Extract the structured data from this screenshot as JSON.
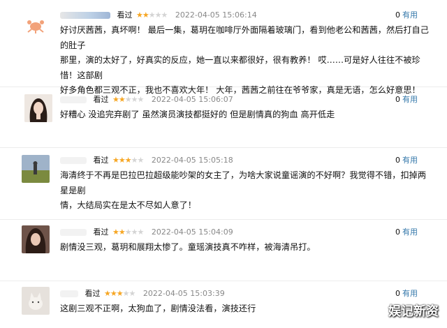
{
  "reviews": [
    {
      "status": "看过",
      "rating": 2,
      "time": "2022-04-05 15:06:14",
      "votes": "0",
      "useful_label": "有用",
      "content": "好讨厌茜茜，真坏啊！ 最后一集，葛玥在咖啡厅外面隔着玻璃门，看到他老公和茜茜，然后打自己的肚子\n那里，演的太好了，好真实的反应，她一直以来都很好，很有教养！ 哎……可是好人往往不被珍惜！这部剧\n好多角色都三观不正，我也不喜欢大年！ 大年，茜茜之前往在爷爷家，真是无语，怎么好意思！"
    },
    {
      "status": "看过",
      "rating": 2,
      "time": "2022-04-05 15:06:07",
      "votes": "0",
      "useful_label": "有用",
      "content": "好糟心 没追完弃剧了 虽然演员演技都挺好的 但是剧情真的狗血 高开低走"
    },
    {
      "status": "看过",
      "rating": 3,
      "time": "2022-04-05 15:05:18",
      "votes": "0",
      "useful_label": "有用",
      "content": "海清终于不再是巴拉巴拉超级能吵架的女主了，为啥大家说童谣演的不好啊？我觉得不错，扣掉两星是剧\n情，大结局实在是太不尽如人意了！"
    },
    {
      "status": "看过",
      "rating": 2,
      "time": "2022-04-05 15:04:09",
      "votes": "0",
      "useful_label": "有用",
      "content": "剧情没三观，葛玥和展翔太惨了。童瑶演技真不咋样，被海清吊打。"
    },
    {
      "status": "看过",
      "rating": 3,
      "time": "2022-04-05 15:03:39",
      "votes": "0",
      "useful_label": "有用",
      "content": "这剧三观不正啊，太狗血了，剧情没法看，演技还行"
    }
  ],
  "watermark": "娱记新资",
  "colors": {
    "star_on": "#f6a623",
    "star_off": "#d4d4d4",
    "link": "#3377aa",
    "time": "#888888"
  }
}
